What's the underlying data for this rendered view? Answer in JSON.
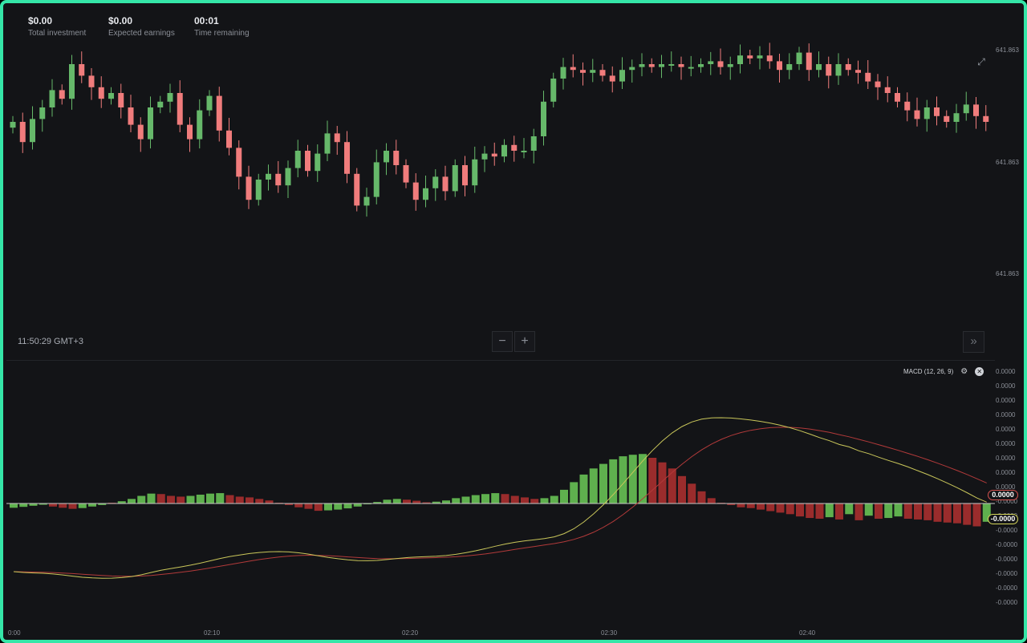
{
  "header": {
    "total_investment": {
      "value": "$0.00",
      "label": "Total investment"
    },
    "expected_earnings": {
      "value": "$0.00",
      "label": "Expected earnings"
    },
    "time_remaining": {
      "value": "00:01",
      "label": "Time remaining"
    }
  },
  "price_axis": [
    "641.863",
    "641.863",
    "641.863"
  ],
  "clock": "11:50:29 GMT+3",
  "zoom": {
    "minus": "−",
    "plus": "+"
  },
  "indicator": {
    "title": "MACD (12, 26, 9)"
  },
  "macd_axis": [
    "0.0000",
    "0.0000",
    "0.0000",
    "0.0000",
    "0.0000",
    "0.0000",
    "0.0000",
    "0.0000",
    "0.0000",
    "-0.0000",
    "-0.0000",
    "-0.0000",
    "-0.0000",
    "-0.0000",
    "-0.0000",
    "-0.0000",
    "-0.0000"
  ],
  "macd_badges": {
    "signal": "0.0000",
    "macd": "-0.0000"
  },
  "time_axis": [
    "0:00",
    "02:10",
    "02:20",
    "02:30",
    "02:40"
  ],
  "colors": {
    "up": "#66b86a",
    "down": "#f07c7c",
    "hist_up": "#5fb04e",
    "hist_down": "#9a2c2c",
    "macd_line": "#c9c65a",
    "signal_line": "#b23a3a",
    "frame": "#35e6a8"
  },
  "icons": {
    "expand": "expand-icon",
    "forward": "double-chevron-right-icon",
    "settings": "gear-icon",
    "close": "close-icon"
  },
  "chart_data": {
    "type": "candlestick",
    "time_ticks": [
      "0:00",
      "02:10",
      "02:20",
      "02:30",
      "02:40"
    ],
    "candles_close_relative": [
      0.7,
      0.63,
      0.71,
      0.75,
      0.81,
      0.78,
      0.9,
      0.86,
      0.82,
      0.78,
      0.8,
      0.75,
      0.69,
      0.64,
      0.75,
      0.77,
      0.8,
      0.69,
      0.64,
      0.74,
      0.79,
      0.67,
      0.61,
      0.51,
      0.43,
      0.5,
      0.52,
      0.48,
      0.54,
      0.6,
      0.53,
      0.59,
      0.66,
      0.63,
      0.52,
      0.41,
      0.44,
      0.56,
      0.6,
      0.55,
      0.49,
      0.43,
      0.47,
      0.51,
      0.46,
      0.55,
      0.48,
      0.57,
      0.59,
      0.58,
      0.62,
      0.6,
      0.6,
      0.65,
      0.77,
      0.85,
      0.89,
      0.88,
      0.87,
      0.88,
      0.86,
      0.84,
      0.88,
      0.89,
      0.9,
      0.89,
      0.9,
      0.9,
      0.89,
      0.89,
      0.9,
      0.91,
      0.89,
      0.9,
      0.93,
      0.92,
      0.93,
      0.91,
      0.88,
      0.9,
      0.94,
      0.88,
      0.9,
      0.86,
      0.9,
      0.88,
      0.87,
      0.84,
      0.82,
      0.8,
      0.77,
      0.74,
      0.71,
      0.75,
      0.72,
      0.7,
      0.73,
      0.76,
      0.72,
      0.7
    ],
    "macd": {
      "params": "12, 26, 9",
      "histogram": [
        -0.28,
        -0.22,
        -0.15,
        -0.08,
        -0.2,
        -0.28,
        -0.35,
        -0.3,
        -0.2,
        -0.1,
        0.05,
        0.15,
        0.3,
        0.5,
        0.65,
        0.62,
        0.5,
        0.45,
        0.5,
        0.58,
        0.65,
        0.68,
        0.55,
        0.45,
        0.4,
        0.3,
        0.2,
        0.05,
        -0.1,
        -0.25,
        -0.35,
        -0.48,
        -0.45,
        -0.4,
        -0.32,
        -0.2,
        -0.05,
        0.1,
        0.25,
        0.3,
        0.25,
        0.18,
        0.08,
        0.12,
        0.2,
        0.35,
        0.45,
        0.55,
        0.62,
        0.68,
        0.62,
        0.5,
        0.4,
        0.3,
        0.35,
        0.5,
        0.9,
        1.4,
        1.9,
        2.3,
        2.6,
        2.9,
        3.1,
        3.2,
        3.25,
        3.0,
        2.7,
        2.3,
        1.8,
        1.3,
        0.8,
        0.35,
        0.05,
        -0.1,
        -0.25,
        -0.3,
        -0.4,
        -0.5,
        -0.6,
        -0.7,
        -0.85,
        -0.95,
        -1.0,
        -0.9,
        -1.05,
        -0.7,
        -1.1,
        -0.8,
        -1.0,
        -0.95,
        -0.85,
        -1.0,
        -1.05,
        -1.1,
        -1.2,
        -1.25,
        -1.3,
        -1.4,
        -1.5,
        -1.2
      ]
    }
  }
}
